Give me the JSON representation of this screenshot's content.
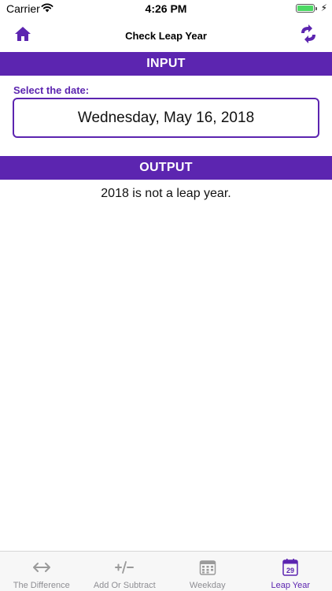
{
  "status_bar": {
    "carrier": "Carrier",
    "time": "4:26 PM"
  },
  "nav": {
    "title": "Check Leap Year",
    "left_icon": "home-icon",
    "right_icon": "swap-icon"
  },
  "input_section": {
    "header": "INPUT",
    "label": "Select the date:",
    "date_value": "Wednesday, May 16, 2018"
  },
  "output_section": {
    "header": "OUTPUT",
    "result": "2018 is not a leap year."
  },
  "tabs": [
    {
      "label": "The Difference",
      "icon": "arrows-horizontal-icon",
      "active": false
    },
    {
      "label": "Add Or Subtract",
      "icon": "plus-minus-icon",
      "active": false
    },
    {
      "label": "Weekday",
      "icon": "calendar-grid-icon",
      "active": false
    },
    {
      "label": "Leap Year",
      "icon": "calendar-29-icon",
      "active": true
    }
  ],
  "colors": {
    "accent": "#5c25b0",
    "tab_inactive": "#8e8e93",
    "battery": "#4cd964"
  }
}
